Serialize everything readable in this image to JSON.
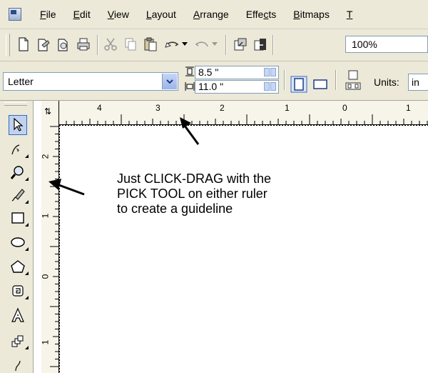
{
  "menu": {
    "items": [
      {
        "label": "File"
      },
      {
        "label": "Edit"
      },
      {
        "label": "View"
      },
      {
        "label": "Layout"
      },
      {
        "label": "Arrange"
      },
      {
        "label": "Effects"
      },
      {
        "label": "Bitmaps"
      },
      {
        "label": "T"
      }
    ]
  },
  "toolbar": {
    "icons": [
      "new-document-icon",
      "open-icon",
      "save-icon",
      "print-icon",
      "cut-icon",
      "copy-icon",
      "paste-icon",
      "undo-icon",
      "redo-icon",
      "import-icon",
      "export-icon"
    ],
    "zoom_value": "100%"
  },
  "property_bar": {
    "paper_size": "Letter",
    "width_value": "8.5 \"",
    "height_value": "11.0 \"",
    "units_label": "Units:",
    "units_value": "in"
  },
  "ruler": {
    "horizontal_labels": [
      "4",
      "3",
      "2",
      "1",
      "0",
      "1"
    ],
    "vertical_labels": [
      "2",
      "1",
      "0",
      "1"
    ],
    "corner_glyph": "⇅"
  },
  "toolbox": {
    "tools": [
      "pick-tool-icon",
      "shape-tool-icon",
      "zoom-tool-icon",
      "freehand-tool-icon",
      "rectangle-tool-icon",
      "ellipse-tool-icon",
      "polygon-tool-icon",
      "spiral-tool-icon",
      "text-tool-icon",
      "interactive-blend-tool-icon"
    ]
  },
  "annotation": {
    "line1": "Just CLICK-DRAG with the",
    "line2": "PICK TOOL on either ruler",
    "line3": "to create a guideline"
  },
  "colors": {
    "chrome": "#ece9d8",
    "ruler": "#f7f4e9",
    "active_tool": "#c1d2ee",
    "canvas": "#ffffff"
  }
}
